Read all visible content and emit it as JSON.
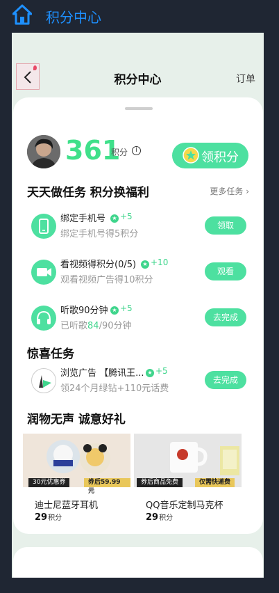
{
  "app": {
    "title": "积分中心"
  },
  "nav": {
    "title": "积分中心",
    "orders_label": "订单"
  },
  "user": {
    "points": "361",
    "points_unit": "积分",
    "info_glyph": "i"
  },
  "earn_button": {
    "label": "领积分"
  },
  "daily": {
    "title": "天天做任务 积分换福利",
    "more_label": "更多任务 ›"
  },
  "tasks": [
    {
      "title": "绑定手机号",
      "reward": "+5",
      "desc": "绑定手机号得5积分",
      "button": "领取",
      "icon": "phone-icon"
    },
    {
      "title": "看视频得积分(0/5)",
      "reward": "+10",
      "desc": "观看视频广告得10积分",
      "button": "观看",
      "icon": "video-camera-icon"
    },
    {
      "title": "听歌90分钟",
      "reward": "+5",
      "desc_prefix": "已听歌",
      "desc_highlight": "84",
      "desc_suffix": "/90分钟",
      "button": "去完成",
      "icon": "headphones-icon"
    }
  ],
  "surprise": {
    "title": "惊喜任务",
    "task": {
      "title": "浏览广告 【腾讯王...",
      "reward": "+5",
      "desc": "领24个月绿钻+110元话费",
      "button": "去完成",
      "icon": "ad-logo-icon"
    }
  },
  "gifts": {
    "title": "润物无声 诚意好礼",
    "items": [
      {
        "name": "迪士尼蓝牙耳机",
        "price": "29",
        "unit": "积分",
        "tag_left": "30元优惠券",
        "tag_right": "券后59.99元"
      },
      {
        "name": "QQ音乐定制马克杯",
        "price": "29",
        "unit": "积分",
        "tag_left": "券后商品免费",
        "tag_right": "仅需快递费"
      }
    ]
  },
  "colors": {
    "accent": "#4de0a0",
    "points": "#3fe08a",
    "title_blue": "#1e90ff"
  }
}
